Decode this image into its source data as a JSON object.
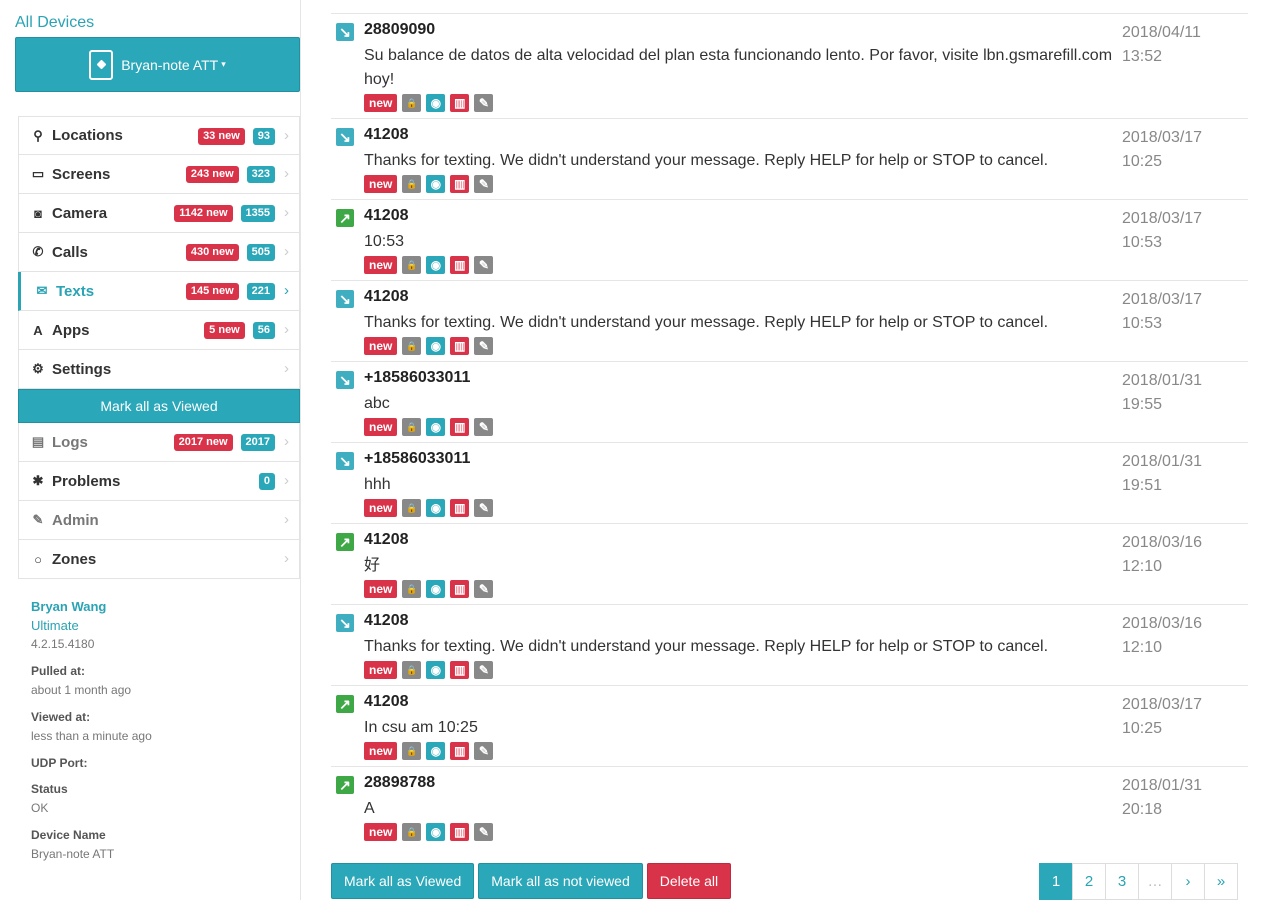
{
  "sidebar": {
    "all_devices": "All Devices",
    "device": {
      "name": "Bryan-note ATT",
      "caret": "▾",
      "icon": "tablet-icon"
    },
    "nav": [
      {
        "key": "locations",
        "label": "Locations",
        "icon": "map-marker-icon",
        "glyph": "⚲",
        "new_badge": "33 new",
        "count": "93"
      },
      {
        "key": "screens",
        "label": "Screens",
        "icon": "monitor-icon",
        "glyph": "▭",
        "new_badge": "243 new",
        "count": "323"
      },
      {
        "key": "camera",
        "label": "Camera",
        "icon": "camera-icon",
        "glyph": "◙",
        "new_badge": "1142 new",
        "count": "1355"
      },
      {
        "key": "calls",
        "label": "Calls",
        "icon": "phone-icon",
        "glyph": "✆",
        "new_badge": "430 new",
        "count": "505"
      },
      {
        "key": "texts",
        "label": "Texts",
        "icon": "envelope-icon",
        "glyph": "✉",
        "new_badge": "145 new",
        "count": "221",
        "active": true
      },
      {
        "key": "apps",
        "label": "Apps",
        "icon": "font-icon",
        "glyph": "A",
        "new_badge": "5 new",
        "count": "56"
      },
      {
        "key": "settings",
        "label": "Settings",
        "icon": "gear-icon",
        "glyph": "⚙"
      },
      {
        "key": "mark",
        "label": "Mark all as Viewed"
      },
      {
        "key": "logs",
        "label": "Logs",
        "icon": "file-icon",
        "glyph": "▤",
        "new_badge": "2017 new",
        "count": "2017",
        "muted": true
      },
      {
        "key": "problems",
        "label": "Problems",
        "icon": "bug-icon",
        "glyph": "✱",
        "count": "0"
      },
      {
        "key": "admin",
        "label": "Admin",
        "icon": "pencil-icon",
        "glyph": "✎",
        "muted": true
      },
      {
        "key": "zones",
        "label": "Zones",
        "icon": "circle-icon",
        "glyph": "○"
      }
    ],
    "chevron": "›",
    "info": {
      "name": "Bryan Wang",
      "plan": "Ultimate",
      "version": "4.2.15.4180",
      "pulled_label": "Pulled at:",
      "pulled_value": "about 1 month ago",
      "viewed_label": "Viewed at:",
      "viewed_value": "less than a minute ago",
      "udp_label": "UDP Port:",
      "status_label": "Status",
      "status_value": "OK",
      "device_name_label": "Device Name",
      "device_name_value": "Bryan-note ATT"
    }
  },
  "messages": [
    {
      "direction": "in",
      "sender": "28809090",
      "body": "Su balance de datos de alta velocidad del plan esta funcionando lento. Por favor, visite lbn.gsmarefill.com hoy!",
      "date": "2018/04/11",
      "time": "13:52",
      "tall": true
    },
    {
      "direction": "in",
      "sender": "41208",
      "body": "Thanks for texting. We didn't understand your message. Reply HELP for help or STOP to cancel.",
      "date": "2018/03/17",
      "time": "10:25"
    },
    {
      "direction": "out",
      "sender": "41208",
      "body": "10:53",
      "date": "2018/03/17",
      "time": "10:53"
    },
    {
      "direction": "in",
      "sender": "41208",
      "body": "Thanks for texting. We didn't understand your message. Reply HELP for help or STOP to cancel.",
      "date": "2018/03/17",
      "time": "10:53"
    },
    {
      "direction": "in",
      "sender": "+18586033011",
      "body": "abc",
      "date": "2018/01/31",
      "time": "19:55"
    },
    {
      "direction": "in",
      "sender": "+18586033011",
      "body": "hhh",
      "date": "2018/01/31",
      "time": "19:51"
    },
    {
      "direction": "out",
      "sender": "41208",
      "body": "好",
      "date": "2018/03/16",
      "time": "12:10"
    },
    {
      "direction": "in",
      "sender": "41208",
      "body": "Thanks for texting. We didn't understand your message. Reply HELP for help or STOP to cancel.",
      "date": "2018/03/16",
      "time": "12:10"
    },
    {
      "direction": "out",
      "sender": "41208",
      "body": "In csu am 10:25",
      "date": "2018/03/17",
      "time": "10:25"
    },
    {
      "direction": "out",
      "sender": "28898788",
      "body": "A",
      "date": "2018/01/31",
      "time": "20:18"
    }
  ],
  "actions": {
    "new_label": "new",
    "lock_glyph": "🔒",
    "eye_glyph": "◉",
    "delete_glyph": "▥",
    "edit_glyph": "✎",
    "in_glyph": "↘",
    "out_glyph": "↗"
  },
  "footer": {
    "mark_viewed": "Mark all as Viewed",
    "mark_not_viewed": "Mark all as not viewed",
    "delete_all": "Delete all"
  },
  "pagination": {
    "pages": [
      "1",
      "2",
      "3"
    ],
    "ellipsis": "…",
    "next": "›",
    "last": "»",
    "current": "1"
  }
}
